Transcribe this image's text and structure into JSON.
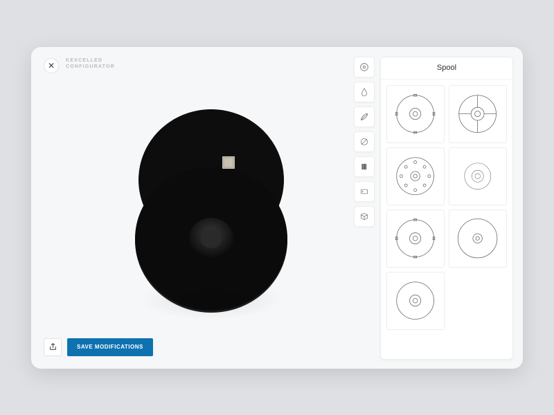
{
  "app": {
    "title_line1": "KEXCELLED",
    "title_line2": "CONFIGURATOR"
  },
  "actions": {
    "close_glyph": "✕",
    "save_label": "SAVE MODIFICATIONS"
  },
  "categories": [
    {
      "id": "spool",
      "label": "Spool",
      "icon": "spool"
    },
    {
      "id": "color",
      "label": "Color",
      "icon": "drop"
    },
    {
      "id": "material",
      "label": "Material",
      "icon": "feather"
    },
    {
      "id": "diameter",
      "label": "Diameter",
      "icon": "slash-circle"
    },
    {
      "id": "texture",
      "label": "Texture",
      "icon": "lines"
    },
    {
      "id": "label",
      "label": "Label",
      "icon": "tag"
    },
    {
      "id": "package",
      "label": "Package",
      "icon": "box"
    }
  ],
  "active_category": "spool",
  "panel": {
    "title": "Spool",
    "options": [
      {
        "id": "sp1",
        "variant": "4lug"
      },
      {
        "id": "sp2",
        "variant": "4lug"
      },
      {
        "id": "sp3",
        "variant": "holes"
      },
      {
        "id": "sp4",
        "variant": "small"
      },
      {
        "id": "sp5",
        "variant": "4lug"
      },
      {
        "id": "sp6",
        "variant": "plain-large"
      },
      {
        "id": "sp7",
        "variant": "plain"
      }
    ]
  }
}
